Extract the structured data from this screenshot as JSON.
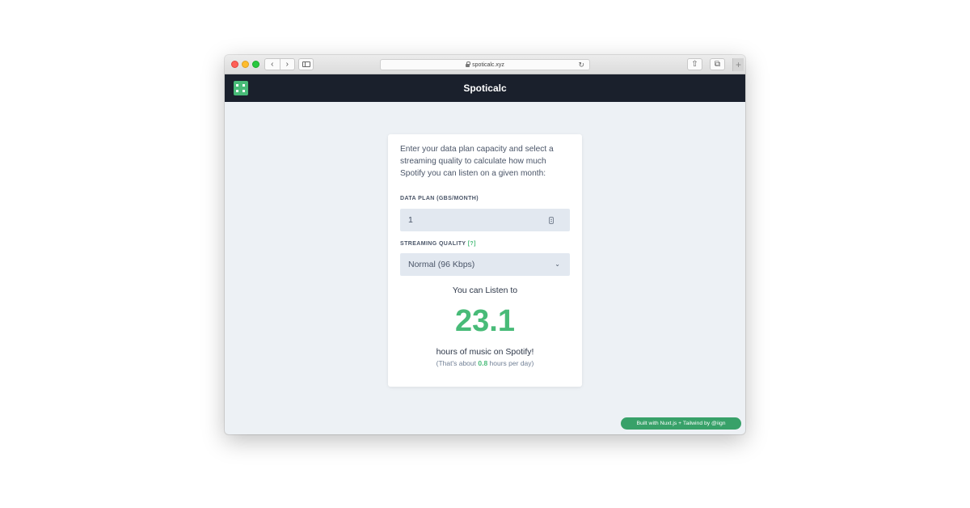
{
  "browser": {
    "url": "spoticalc.xyz",
    "back_glyph": "‹",
    "forward_glyph": "›",
    "reload_glyph": "↻",
    "share_glyph": "⇧",
    "tabs_glyph": "⧉",
    "new_tab_glyph": "+"
  },
  "app": {
    "title": "Spoticalc",
    "accent_color": "#48bb78",
    "header_color": "#1a202c"
  },
  "calculator": {
    "intro": "Enter your data plan capacity and select a streaming quality to calculate how much Spotify you can listen on a given month:",
    "data_plan_label": "DATA PLAN (GBS/MONTH)",
    "data_plan_value": "1",
    "quality_label": "STREAMING QUALITY",
    "quality_help": "[?]",
    "quality_selected": "Normal (96 Kbps)",
    "chevron_glyph": "⌄"
  },
  "result": {
    "lead": "You can Listen to",
    "hours": "23.1",
    "tail": "hours of music on Spotify!",
    "per_day_prefix": "(That's about ",
    "per_day_value": "0.8",
    "per_day_suffix": " hours per day)"
  },
  "footer": {
    "credit": "Built with Nuxt.js + Tailwind by @iign"
  }
}
